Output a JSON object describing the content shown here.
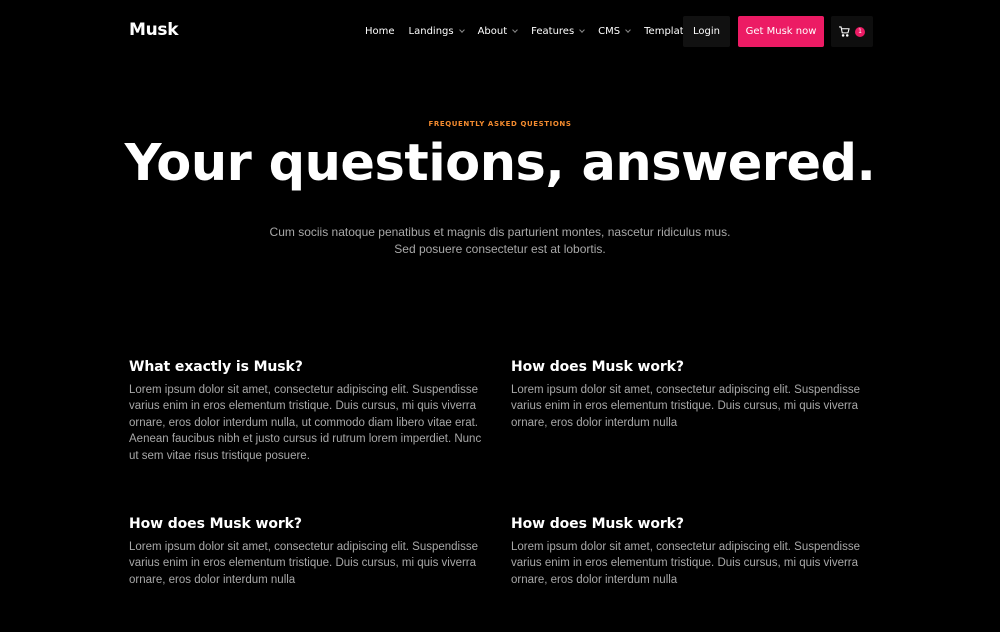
{
  "brand": {
    "logo": "Musk",
    "accent": "#ec1b64",
    "eyebrow_color": "#f28a2e"
  },
  "nav": {
    "items": [
      {
        "label": "Home",
        "dropdown": false
      },
      {
        "label": "Landings",
        "dropdown": true
      },
      {
        "label": "About",
        "dropdown": true
      },
      {
        "label": "Features",
        "dropdown": true
      },
      {
        "label": "CMS",
        "dropdown": true
      },
      {
        "label": "Template",
        "dropdown": true
      }
    ],
    "login_label": "Login",
    "cta_label": "Get Musk now",
    "cart_icon": "cart-icon",
    "cart_count": "1"
  },
  "hero": {
    "eyebrow": "FREQUENTLY ASKED QUESTIONS",
    "title": "Your questions, answered.",
    "subtitle": "Cum sociis natoque penatibus et magnis dis parturient montes, nascetur ridiculus mus. Sed posuere consectetur est at lobortis."
  },
  "faqs": [
    {
      "question": "What exactly is Musk?",
      "answer": "Lorem ipsum dolor sit amet, consectetur adipiscing elit. Suspendisse varius enim in eros elementum tristique. Duis cursus, mi quis viverra ornare, eros dolor interdum nulla, ut commodo diam libero vitae erat. Aenean faucibus nibh et justo cursus id rutrum lorem imperdiet. Nunc ut sem vitae risus tristique posuere."
    },
    {
      "question": "How does Musk work?",
      "answer": "Lorem ipsum dolor sit amet, consectetur adipiscing elit. Suspendisse varius enim in eros elementum tristique. Duis cursus, mi quis viverra ornare, eros dolor interdum nulla"
    },
    {
      "question": "How does Musk work?",
      "answer": "Lorem ipsum dolor sit amet, consectetur adipiscing elit. Suspendisse varius enim in eros elementum tristique. Duis cursus, mi quis viverra ornare, eros dolor interdum nulla"
    },
    {
      "question": "How does Musk work?",
      "answer": "Lorem ipsum dolor sit amet, consectetur adipiscing elit. Suspendisse varius enim in eros elementum tristique. Duis cursus, mi quis viverra ornare, eros dolor interdum nulla"
    }
  ]
}
